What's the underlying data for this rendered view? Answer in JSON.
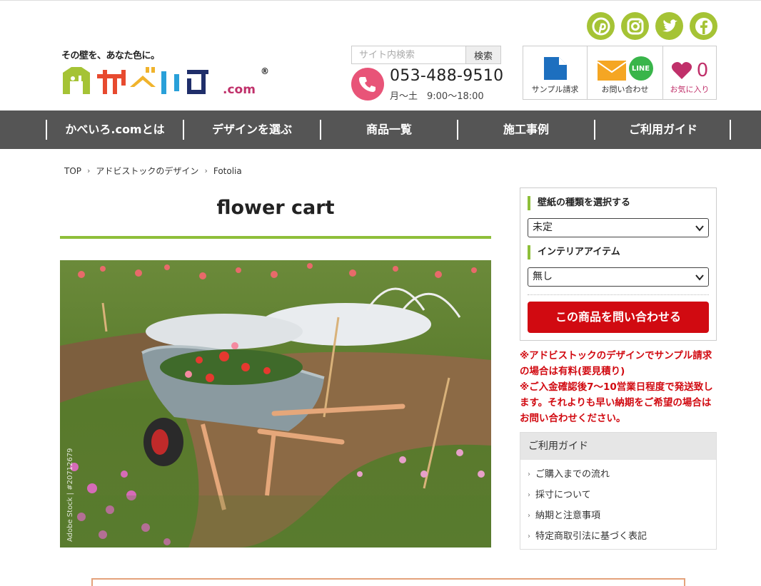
{
  "header": {
    "tagline": "その壁を、あなた色に。",
    "logo_text": "かべいろ.com",
    "search_placeholder": "サイト内検索",
    "search_button": "検索",
    "phone": "053-488-9510",
    "hours": "月〜土　9:00〜18:00",
    "sample_label": "サンプル請求",
    "contact_label": "お問い合わせ",
    "line_label": "LINE",
    "fav_label": "お気に入り",
    "fav_count": "0"
  },
  "social": [
    "pinterest-icon",
    "instagram-icon",
    "twitter-icon",
    "facebook-icon"
  ],
  "nav": {
    "items": [
      "かべいろ.comとは",
      "デザインを選ぶ",
      "商品一覧",
      "施工事例",
      "ご利用ガイド"
    ]
  },
  "breadcrumb": [
    "TOP",
    "アドビストックのデザイン",
    "Fotolia"
  ],
  "product": {
    "title": "flower cart",
    "stock_credit": "Adobe Stock | #20712679"
  },
  "form": {
    "type_heading": "壁紙の種類を選択する",
    "type_value": "未定",
    "item_heading": "インテリアアイテム",
    "item_value": "無し",
    "inquire_button": "この商品を問い合わせる"
  },
  "notes": [
    "※アドビストックのデザインでサンプル請求の場合は有料(要見積り)",
    "※ご入金確認後7〜10営業日程度で発送致します。それよりも早い納期をご希望の場合はお問い合わせください。"
  ],
  "guide": {
    "heading": "ご利用ガイド",
    "items": [
      "ご購入までの流れ",
      "採寸について",
      "納期と注意事項",
      "特定商取引法に基づく表記"
    ]
  },
  "colors": {
    "accent_green": "#8ebf3a",
    "social_green": "#a5c335",
    "nav_gray": "#555555",
    "cta_red": "#d10a11",
    "phone_pink": "#e85478",
    "fav_pink": "#c0306a"
  }
}
